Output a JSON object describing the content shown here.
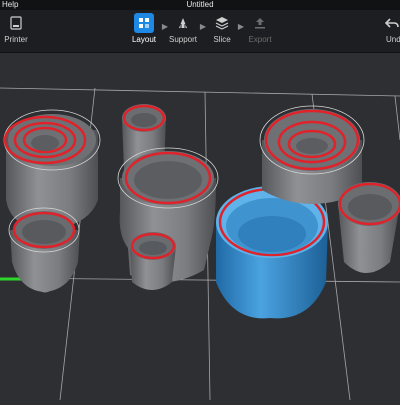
{
  "window": {
    "menu_help": "Help",
    "title": "Untitled"
  },
  "toolbar": {
    "printer_label": "Printer",
    "steps": [
      {
        "label": "Layout",
        "state": "active"
      },
      {
        "label": "Support",
        "state": "normal"
      },
      {
        "label": "Slice",
        "state": "normal"
      },
      {
        "label": "Export",
        "state": "disabled"
      }
    ],
    "undo_label": "Undo"
  },
  "colors": {
    "accent": "#1e88e5",
    "part_gray": "#7d7f83",
    "selected_part": "#3a8fd0",
    "outline_red": "#e0222a",
    "axis_green": "#2dd62d"
  }
}
